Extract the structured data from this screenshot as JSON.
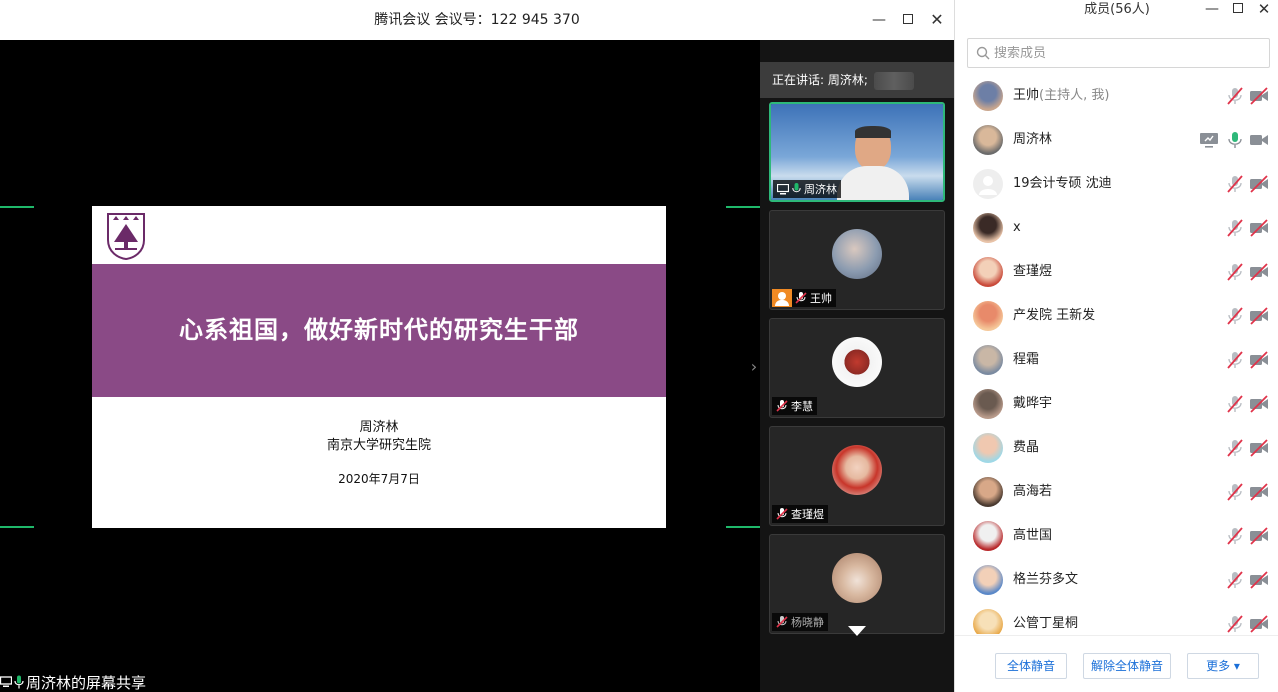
{
  "window": {
    "title": "腾讯会议 会议号：122 945 370"
  },
  "slide": {
    "title": "心系祖国，做好新时代的研究生干部",
    "author": "周济林",
    "org": "南京大学研究生院",
    "date": "2020年7月7日"
  },
  "share_label": "周济林的屏幕共享",
  "strip": {
    "speaking": "正在讲话: 周济林;",
    "tiles": [
      {
        "name": "周济林"
      },
      {
        "name": "王帅"
      },
      {
        "name": "李慧"
      },
      {
        "name": "查瑾煜"
      },
      {
        "name": "杨晓静"
      }
    ]
  },
  "panel": {
    "title": "成员(56人)",
    "search_placeholder": "搜索成员",
    "members": [
      {
        "name": "王帅",
        "role": "(主持人, 我)"
      },
      {
        "name": "周济林",
        "role": ""
      },
      {
        "name": "19会计专硕 沈迪",
        "role": ""
      },
      {
        "name": "x",
        "role": ""
      },
      {
        "name": "查瑾煜",
        "role": ""
      },
      {
        "name": "产发院 王新发",
        "role": ""
      },
      {
        "name": "程霜",
        "role": ""
      },
      {
        "name": "戴晔宇",
        "role": ""
      },
      {
        "name": "费晶",
        "role": ""
      },
      {
        "name": "高海若",
        "role": ""
      },
      {
        "name": "高世国",
        "role": ""
      },
      {
        "name": "格兰芬多文",
        "role": ""
      },
      {
        "name": "公管丁星桐",
        "role": ""
      }
    ],
    "buttons": {
      "mute_all": "全体静音",
      "unmute_all": "解除全体静音",
      "more": "更多 ▾"
    }
  },
  "colors": {
    "accent": "#2eb87a",
    "slide_band": "#8a4a86",
    "link": "#1a6fd8",
    "muted": "#e0334a"
  }
}
